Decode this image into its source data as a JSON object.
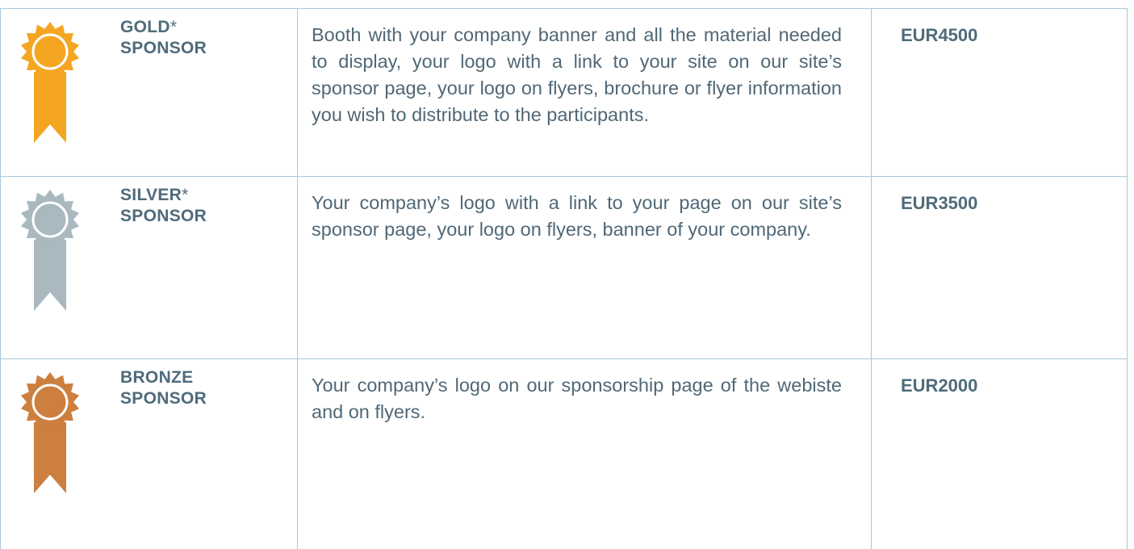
{
  "sponsors": [
    {
      "tier_line1": "GOLD",
      "tier_star": "*",
      "tier_line2": "SPONSOR",
      "badge_icon": "gold-ribbon-badge-icon",
      "badge_color": "#f4a623",
      "description": "Booth with your company banner and all the material needed to display, your logo with a link to your site on our site’s sponsor page, your logo on flyers, brochure or flyer information you wish to distribute to the participants.",
      "price": "EUR4500"
    },
    {
      "tier_line1": "SILVER",
      "tier_star": "*",
      "tier_line2": "SPONSOR",
      "badge_icon": "silver-ribbon-badge-icon",
      "badge_color": "#a9b9bf",
      "description": "Your company’s logo with a link to your page on our site’s sponsor page, your logo on flyers, banner of your company.",
      "price": "EUR3500"
    },
    {
      "tier_line1": "BRONZE",
      "tier_star": "",
      "tier_line2": "SPONSOR",
      "badge_icon": "bronze-ribbon-badge-icon",
      "badge_color": "#cc7f3e",
      "description": "Your company’s logo on our sponsorship page of the webiste and on flyers.",
      "price": "EUR2000"
    }
  ],
  "colors": {
    "text": "#4f6b7b",
    "border": "#a9c9da"
  }
}
